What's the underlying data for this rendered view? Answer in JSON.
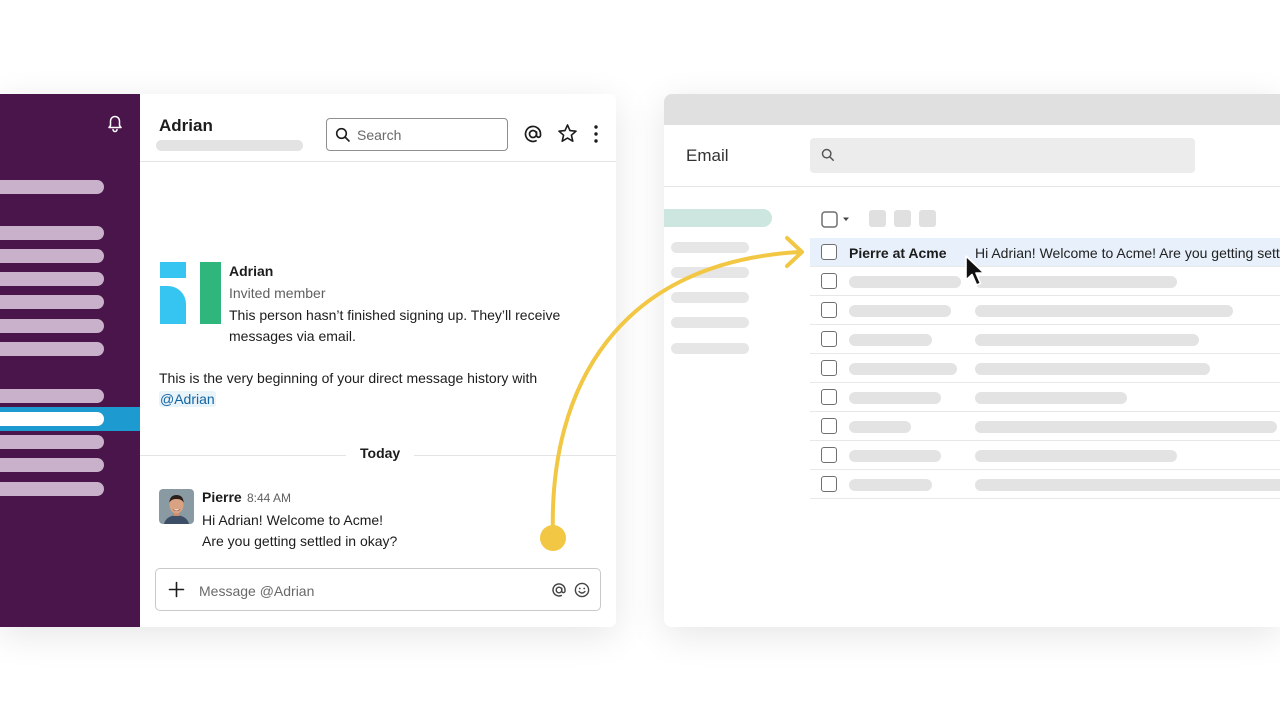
{
  "slack": {
    "channel_name": "Adrian",
    "search_placeholder": "Search",
    "profile": {
      "name": "Adrian",
      "role": "Invited member",
      "description": "This person hasn’t finished signing up. They’ll receive messages via email."
    },
    "intro_text": "This is the very beginning of your direct message history with",
    "intro_mention": "@Adrian",
    "divider_label": "Today",
    "message": {
      "author": "Pierre",
      "time": "8:44 AM",
      "line1": "Hi Adrian! Welcome to Acme!",
      "line2": "Are you getting settled in okay?"
    },
    "composer_placeholder": "Message @Adrian",
    "icons": {
      "notifications": "bell-icon",
      "search": "search-icon",
      "mentions": "at-sign-icon",
      "star": "star-icon",
      "more": "more-vertical-icon",
      "add": "plus-icon",
      "emoji": "emoji-icon"
    },
    "colors": {
      "sidebar": "#4a154b",
      "sidebar_item": "#c9b1cb",
      "active_item": "#1d9bd1",
      "mention_text": "#1264a3"
    }
  },
  "email": {
    "title": "Email",
    "highlighted_row": {
      "from": "Pierre at Acme",
      "snippet": "Hi Adrian! Welcome to Acme! Are you getting settled in okay?"
    },
    "colors": {
      "highlight": "#e8f1fb",
      "active_nav": "#cde6e0"
    }
  },
  "arrow": {
    "color": "#f2c744"
  }
}
